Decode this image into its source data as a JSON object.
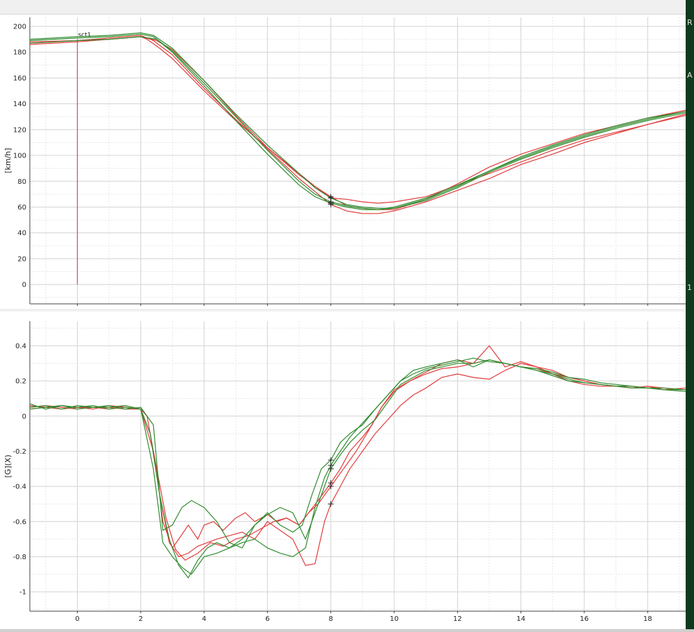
{
  "side_labels": [
    "R",
    "A",
    "1"
  ],
  "colors": {
    "red": "#e23b3b",
    "green": "#2e8b2e",
    "marker": "#d4556e",
    "grid": "#d4d4d4",
    "grid_minor": "#e6e6e6"
  },
  "chart_data": [
    {
      "type": "line",
      "title": "",
      "xlabel": "",
      "ylabel": "[km/h]",
      "xlim": [
        -1.5,
        19.2
      ],
      "ylim": [
        -15,
        207
      ],
      "xticks": [
        0,
        2,
        4,
        6,
        8,
        10,
        12,
        14,
        16,
        18
      ],
      "yticks": [
        0,
        20,
        40,
        60,
        80,
        100,
        120,
        140,
        160,
        180,
        200
      ],
      "grid": true,
      "cursor_x": 0,
      "cursor_label": "sct1",
      "marker_x": 8,
      "series": [
        {
          "color": "red",
          "x": [
            -1.5,
            0,
            1,
            2,
            2.2,
            2.6,
            3,
            4,
            5,
            6,
            7,
            7.5,
            8,
            8.5,
            9,
            9.5,
            10,
            11,
            12,
            13,
            14,
            15,
            16,
            17,
            18,
            19.2
          ],
          "y": [
            187,
            189,
            190,
            192,
            190,
            183,
            175,
            150,
            127,
            106,
            86,
            76,
            67,
            66,
            64,
            63,
            64,
            68,
            77,
            86,
            95,
            104,
            112,
            118,
            124,
            132
          ]
        },
        {
          "color": "red",
          "x": [
            -1.5,
            0,
            1,
            2,
            2.4,
            3,
            4,
            5,
            6,
            7,
            7.5,
            8,
            8.5,
            9,
            9.5,
            10,
            11,
            12,
            13,
            14,
            15,
            16,
            17,
            18,
            19.2
          ],
          "y": [
            188,
            189,
            191,
            193,
            189,
            178,
            152,
            128,
            105,
            82,
            72,
            62,
            57,
            55,
            55,
            57,
            64,
            73,
            82,
            93,
            101,
            110,
            117,
            124,
            131
          ]
        },
        {
          "color": "red",
          "x": [
            -1.5,
            0,
            1,
            2,
            2.5,
            3,
            4,
            5,
            6,
            7,
            7.5,
            8,
            8.5,
            9,
            9.5,
            10,
            11,
            12,
            13,
            14,
            15,
            16,
            17,
            18,
            19.2
          ],
          "y": [
            186,
            188,
            190,
            192,
            189,
            182,
            158,
            131,
            106,
            85,
            76,
            68,
            61,
            59,
            58,
            58,
            66,
            78,
            91,
            101,
            109,
            117,
            123,
            129,
            135
          ]
        },
        {
          "color": "green",
          "x": [
            -1.5,
            0,
            1,
            2,
            2.4,
            3,
            4,
            5,
            6,
            7,
            7.5,
            8,
            8.5,
            9,
            9.5,
            10,
            11,
            12,
            13,
            14,
            15,
            16,
            17,
            18,
            19.2
          ],
          "y": [
            189,
            191,
            192,
            194,
            192,
            181,
            156,
            130,
            104,
            80,
            70,
            64,
            61,
            59,
            58,
            59,
            66,
            76,
            88,
            99,
            108,
            116,
            123,
            129,
            134
          ]
        },
        {
          "color": "green",
          "x": [
            -1.5,
            0,
            1,
            2,
            2.4,
            3,
            4,
            5,
            6,
            7,
            7.5,
            8,
            8.5,
            9,
            9.5,
            10,
            11,
            12,
            13,
            14,
            15,
            16,
            17,
            18,
            19.2
          ],
          "y": [
            190,
            192,
            193,
            195,
            193,
            183,
            158,
            132,
            108,
            86,
            75,
            67,
            62,
            60,
            59,
            59,
            65,
            75,
            87,
            97,
            106,
            114,
            121,
            127,
            133
          ]
        },
        {
          "color": "green",
          "x": [
            -1.5,
            0,
            1,
            2,
            2.5,
            3,
            4,
            5,
            6,
            7,
            7.5,
            8,
            8.5,
            9,
            9.5,
            10,
            11,
            12,
            13,
            14,
            15,
            16,
            17,
            18,
            19.2
          ],
          "y": [
            187,
            189,
            190,
            192,
            190,
            180,
            154,
            127,
            101,
            77,
            68,
            63,
            60,
            58,
            58,
            60,
            67,
            77,
            88,
            98,
            107,
            115,
            122,
            128,
            134
          ]
        }
      ]
    },
    {
      "type": "line",
      "title": "",
      "xlabel": "",
      "ylabel": "[G](X)",
      "xlim": [
        -1.5,
        19.2
      ],
      "ylim": [
        -1.11,
        0.54
      ],
      "xticks": [
        0,
        2,
        4,
        6,
        8,
        10,
        12,
        14,
        16,
        18
      ],
      "yticks": [
        -1,
        -0.8,
        -0.6,
        -0.4,
        -0.2,
        0,
        0.2,
        0.4
      ],
      "grid": true,
      "marker_x": 8,
      "series": [
        {
          "color": "red",
          "x": [
            -1.5,
            -1,
            -0.5,
            0,
            0.5,
            1,
            1.5,
            2,
            2.2,
            2.5,
            2.7,
            3,
            3.2,
            3.5,
            3.8,
            4,
            4.3,
            4.6,
            5,
            5.3,
            5.6,
            6,
            6.3,
            6.6,
            7,
            7.3,
            7.6,
            8,
            8.3,
            8.6,
            9,
            9.3,
            9.6,
            10,
            10.5,
            11,
            11.5,
            12,
            12.5,
            13,
            13.5,
            14,
            14.5,
            15,
            15.5,
            16,
            16.5,
            17,
            17.5,
            18,
            18.5,
            19.2
          ],
          "y": [
            0.06,
            0.05,
            0.04,
            0.05,
            0.05,
            0.04,
            0.06,
            0.04,
            0.0,
            -0.3,
            -0.6,
            -0.75,
            -0.7,
            -0.62,
            -0.7,
            -0.62,
            -0.6,
            -0.65,
            -0.58,
            -0.55,
            -0.6,
            -0.56,
            -0.6,
            -0.58,
            -0.62,
            -0.55,
            -0.48,
            -0.38,
            -0.3,
            -0.2,
            -0.12,
            -0.05,
            0.05,
            0.15,
            0.2,
            0.25,
            0.3,
            0.32,
            0.3,
            0.4,
            0.28,
            0.31,
            0.28,
            0.24,
            0.2,
            0.18,
            0.17,
            0.17,
            0.16,
            0.17,
            0.15,
            0.16
          ]
        },
        {
          "color": "red",
          "x": [
            -1.5,
            -1,
            -0.5,
            0,
            0.5,
            1,
            1.5,
            2,
            2.3,
            2.6,
            2.9,
            3.2,
            3.5,
            3.8,
            4.1,
            4.4,
            4.8,
            5.2,
            5.6,
            6,
            6.4,
            6.8,
            7.2,
            7.5,
            7.8,
            8,
            8.3,
            8.6,
            9,
            9.4,
            9.8,
            10.2,
            10.6,
            11,
            11.5,
            12,
            12.5,
            13,
            13.5,
            14,
            14.5,
            15,
            15.5,
            16,
            16.5,
            17,
            17.5,
            18,
            18.5,
            19.2
          ],
          "y": [
            0.05,
            0.06,
            0.05,
            0.04,
            0.05,
            0.05,
            0.04,
            0.04,
            -0.1,
            -0.45,
            -0.72,
            -0.8,
            -0.78,
            -0.74,
            -0.72,
            -0.7,
            -0.68,
            -0.66,
            -0.7,
            -0.6,
            -0.65,
            -0.7,
            -0.85,
            -0.84,
            -0.6,
            -0.5,
            -0.4,
            -0.3,
            -0.2,
            -0.1,
            -0.02,
            0.06,
            0.12,
            0.16,
            0.22,
            0.24,
            0.22,
            0.21,
            0.26,
            0.3,
            0.28,
            0.26,
            0.22,
            0.2,
            0.18,
            0.17,
            0.16,
            0.17,
            0.16,
            0.15
          ]
        },
        {
          "color": "red",
          "x": [
            -1.5,
            -1,
            -0.5,
            0,
            0.5,
            1,
            1.5,
            2,
            2.4,
            2.8,
            3.1,
            3.4,
            3.8,
            4.2,
            4.6,
            5,
            5.4,
            5.8,
            6.2,
            6.6,
            7,
            7.3,
            7.6,
            8,
            8.4,
            8.8,
            9.2,
            9.6,
            10,
            10.5,
            11,
            11.5,
            12,
            12.5,
            13,
            13.5,
            14,
            14.5,
            15,
            15.5,
            16,
            16.5,
            17,
            17.5,
            18,
            18.5,
            19.2
          ],
          "y": [
            0.04,
            0.05,
            0.06,
            0.05,
            0.04,
            0.06,
            0.05,
            0.04,
            -0.2,
            -0.58,
            -0.76,
            -0.82,
            -0.78,
            -0.72,
            -0.74,
            -0.7,
            -0.68,
            -0.64,
            -0.6,
            -0.58,
            -0.62,
            -0.55,
            -0.5,
            -0.4,
            -0.3,
            -0.2,
            -0.08,
            0.05,
            0.14,
            0.2,
            0.24,
            0.27,
            0.28,
            0.3,
            0.32,
            0.3,
            0.28,
            0.27,
            0.24,
            0.22,
            0.2,
            0.18,
            0.17,
            0.17,
            0.16,
            0.16,
            0.15
          ]
        },
        {
          "color": "green",
          "x": [
            -1.5,
            -1,
            -0.5,
            0,
            0.5,
            1,
            1.5,
            2,
            2.3,
            2.6,
            2.9,
            3.2,
            3.5,
            3.8,
            4.1,
            4.4,
            4.8,
            5.2,
            5.6,
            6,
            6.4,
            6.8,
            7.1,
            7.4,
            7.7,
            8,
            8.3,
            8.6,
            9,
            9.4,
            9.8,
            10.2,
            10.6,
            11,
            11.5,
            12,
            12.5,
            13,
            13.5,
            14,
            14.5,
            15,
            15.5,
            16,
            16.5,
            17,
            17.5,
            18,
            18.5,
            19.2
          ],
          "y": [
            0.07,
            0.04,
            0.06,
            0.05,
            0.06,
            0.04,
            0.05,
            0.04,
            -0.1,
            -0.45,
            -0.7,
            -0.85,
            -0.92,
            -0.82,
            -0.75,
            -0.72,
            -0.75,
            -0.7,
            -0.62,
            -0.55,
            -0.62,
            -0.66,
            -0.62,
            -0.45,
            -0.3,
            -0.25,
            -0.15,
            -0.1,
            -0.05,
            0.04,
            0.12,
            0.2,
            0.26,
            0.28,
            0.3,
            0.32,
            0.28,
            0.32,
            0.3,
            0.28,
            0.26,
            0.23,
            0.2,
            0.19,
            0.18,
            0.17,
            0.16,
            0.16,
            0.15,
            0.14
          ]
        },
        {
          "color": "green",
          "x": [
            -1.5,
            -1,
            -0.5,
            0,
            0.5,
            1,
            1.5,
            2,
            2.4,
            2.7,
            3.0,
            3.3,
            3.6,
            4.0,
            4.4,
            4.8,
            5.2,
            5.6,
            6,
            6.4,
            6.8,
            7.2,
            7.5,
            7.8,
            8,
            8.3,
            8.6,
            9,
            9.4,
            9.8,
            10.2,
            10.6,
            11,
            11.5,
            12,
            12.5,
            13,
            13.5,
            14,
            14.5,
            15,
            15.5,
            16,
            16.5,
            17,
            17.5,
            18,
            18.5,
            19.2
          ],
          "y": [
            0.05,
            0.06,
            0.04,
            0.06,
            0.05,
            0.06,
            0.04,
            0.05,
            -0.05,
            -0.65,
            -0.62,
            -0.52,
            -0.48,
            -0.52,
            -0.6,
            -0.72,
            -0.75,
            -0.62,
            -0.56,
            -0.52,
            -0.55,
            -0.7,
            -0.55,
            -0.4,
            -0.3,
            -0.22,
            -0.15,
            -0.08,
            -0.02,
            0.08,
            0.18,
            0.22,
            0.26,
            0.28,
            0.3,
            0.3,
            0.32,
            0.3,
            0.28,
            0.27,
            0.25,
            0.22,
            0.21,
            0.19,
            0.18,
            0.17,
            0.16,
            0.16,
            0.15
          ]
        },
        {
          "color": "green",
          "x": [
            -1.5,
            -1,
            -0.5,
            0,
            0.5,
            1,
            1.5,
            2,
            2.4,
            2.7,
            3.0,
            3.3,
            3.6,
            4.0,
            4.4,
            4.8,
            5.2,
            5.6,
            6,
            6.4,
            6.8,
            7.2,
            7.5,
            7.8,
            8,
            8.3,
            8.6,
            9,
            9.4,
            9.8,
            10.2,
            10.6,
            11,
            11.5,
            12,
            12.5,
            13,
            13.5,
            14,
            14.5,
            15,
            15.5,
            16,
            16.5,
            17,
            17.5,
            18,
            18.5,
            19.2
          ],
          "y": [
            0.04,
            0.05,
            0.06,
            0.04,
            0.05,
            0.05,
            0.06,
            0.04,
            -0.3,
            -0.72,
            -0.8,
            -0.86,
            -0.9,
            -0.8,
            -0.78,
            -0.75,
            -0.72,
            -0.7,
            -0.75,
            -0.78,
            -0.8,
            -0.75,
            -0.52,
            -0.35,
            -0.28,
            -0.2,
            -0.12,
            -0.04,
            0.04,
            0.12,
            0.2,
            0.24,
            0.27,
            0.29,
            0.31,
            0.33,
            0.31,
            0.3,
            0.28,
            0.26,
            0.24,
            0.21,
            0.19,
            0.18,
            0.17,
            0.17,
            0.16,
            0.15,
            0.15
          ]
        }
      ]
    }
  ]
}
